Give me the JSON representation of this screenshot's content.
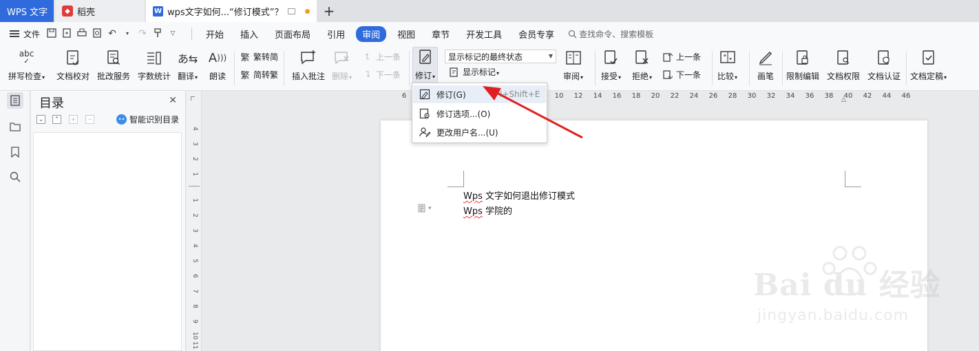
{
  "tabs": {
    "app": "WPS 文字",
    "docer": "稻壳",
    "doc_title": "wps文字如何...“修订模式”？",
    "add": "+"
  },
  "menubar": {
    "file": "文件",
    "items": [
      "开始",
      "插入",
      "页面布局",
      "引用",
      "审阅",
      "视图",
      "章节",
      "开发工具",
      "会员专享"
    ],
    "active": "审阅",
    "search_placeholder": "查找命令、搜索模板"
  },
  "ribbon": {
    "spellcheck": "拼写检查",
    "proofread": "文档校对",
    "correction_service": "批改服务",
    "word_count": "字数统计",
    "translate": "翻译",
    "read_aloud": "朗读",
    "trad_to_simp": "繁转简",
    "simp_to_trad": "简转繁",
    "insert_comment": "插入批注",
    "delete": "删除",
    "prev": "上一条",
    "next": "下一条",
    "revise": "修订",
    "markup_state": "显示标记的最终状态",
    "show_markup": "显示标记",
    "review": "审阅",
    "accept": "接受",
    "reject": "拒绝",
    "prev_change": "上一条",
    "next_change": "下一条",
    "compare": "比较",
    "pen": "画笔",
    "restrict_edit": "限制编辑",
    "doc_permission": "文档权限",
    "doc_cert": "文档认证",
    "finalize": "文档定稿"
  },
  "toc": {
    "title": "目录",
    "smart": "智能识别目录"
  },
  "ruler": {
    "h_ticks": [
      "6",
      "10",
      "12",
      "14",
      "16",
      "18",
      "20",
      "22",
      "24",
      "26",
      "28",
      "30",
      "32",
      "34",
      "36",
      "38",
      "40",
      "42",
      "44",
      "46"
    ],
    "v_ticks": [
      "4",
      "3",
      "2",
      "1",
      "1",
      "1",
      "2",
      "3",
      "4",
      "5",
      "6",
      "7",
      "8",
      "9",
      "10",
      "11"
    ]
  },
  "dropdown": {
    "revise": "修订(G)",
    "revise_shortcut": "l+Shift+E",
    "options": "修订选项...(O)",
    "change_user": "更改用户名...(U)"
  },
  "document": {
    "line1_prefix": "Wps",
    "line1_rest": " 文字如何退出修订模式",
    "line2_prefix": "Wps",
    "line2_rest": " 学院的"
  },
  "watermark": {
    "brand": "Bai du 经验",
    "url": "jingyan.baidu.com"
  },
  "colors": {
    "accent": "#2f6bdc",
    "arrow": "#e02020"
  }
}
